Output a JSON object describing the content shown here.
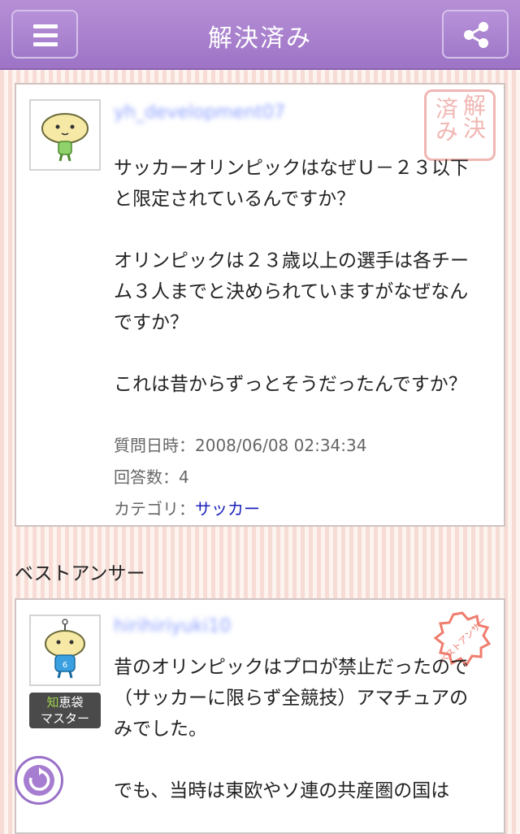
{
  "header": {
    "title": "解決済み",
    "menu_icon": "hamburger-menu-icon",
    "share_icon": "share-icon"
  },
  "question": {
    "username": "yh_development07",
    "solved_stamp": [
      "解決",
      "済み"
    ],
    "body": "サッカーオリンピックはなぜＵ－２３以下と限定されているんですか？\n\nオリンピックは２３歳以上の選手は各チーム３人までと決められていますがなぜなんですか？\n\nこれは昔からずっとそうだったんですか？",
    "date_label": "質問日時：",
    "date_value": "2008/06/08 02:34:34",
    "answers_label": "回答数：",
    "answers_value": "4",
    "category_label": "カテゴリ：",
    "category_value": "サッカー"
  },
  "best_answer": {
    "section_title": "ベストアンサー",
    "username": "hirihiriyuki10",
    "stamp_text": "ベストアンサー",
    "badge_line1_accent": "知",
    "badge_line1_rest": "恵袋",
    "badge_line2": "マスター",
    "avatar_number": "6",
    "body": "昔のオリンピックはプロが禁止だったので（サッカーに限らず全競技）アマチュアのみでした。\n\nでも、当時は東欧やソ連の共産圏の国は"
  },
  "colors": {
    "header": "#a47dcc",
    "link": "#1a22b8",
    "stamp": "#f0b7b3",
    "best_stamp": "#ef7d6e"
  }
}
